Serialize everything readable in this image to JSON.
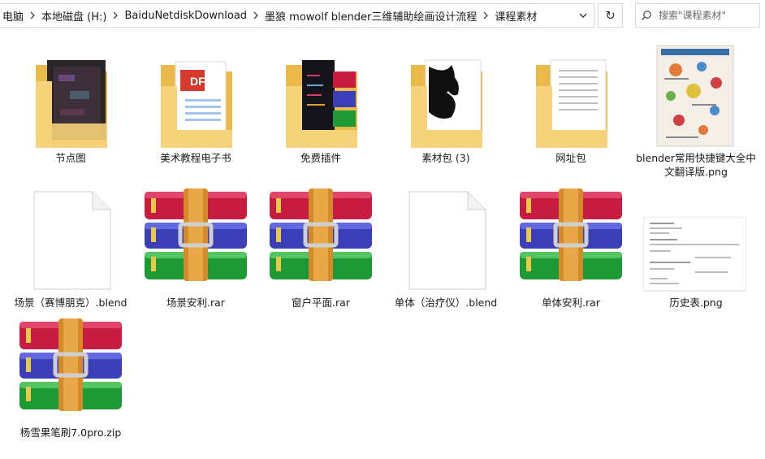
{
  "address_bar": {
    "crumbs": [
      "电脑",
      "本地磁盘 (H:)",
      "BaiduNetdiskDownload",
      "墨狼 mowolf blender三维辅助绘画设计流程",
      "课程素材"
    ]
  },
  "search": {
    "placeholder": "搜索\"课程素材\""
  },
  "icons": {
    "separator": "chevron-right-icon",
    "dropdown": "chevron-down-icon",
    "refresh": "refresh-icon",
    "search": "search-icon"
  },
  "colors": {
    "folder": "#f2c75c",
    "border": "#d9d9d9"
  },
  "files": [
    {
      "name": "节点图",
      "type": "folder"
    },
    {
      "name": "美术教程电子书",
      "type": "folder"
    },
    {
      "name": "免费插件",
      "type": "folder"
    },
    {
      "name": "素材包 (3)",
      "type": "folder"
    },
    {
      "name": "网址包",
      "type": "folder"
    },
    {
      "name": "blender常用快捷键大全中文翻译版.png",
      "type": "image"
    },
    {
      "name": "场景（赛博朋克）.blend",
      "type": "blend"
    },
    {
      "name": "场景安利.rar",
      "type": "rar"
    },
    {
      "name": "窗户平面.rar",
      "type": "rar"
    },
    {
      "name": "单体（治疗仪）.blend",
      "type": "blend"
    },
    {
      "name": "单体安利.rar",
      "type": "rar"
    },
    {
      "name": "历史表.png",
      "type": "image"
    },
    {
      "name": "杨雪果笔刷7.0pro.zip",
      "type": "rar"
    }
  ]
}
